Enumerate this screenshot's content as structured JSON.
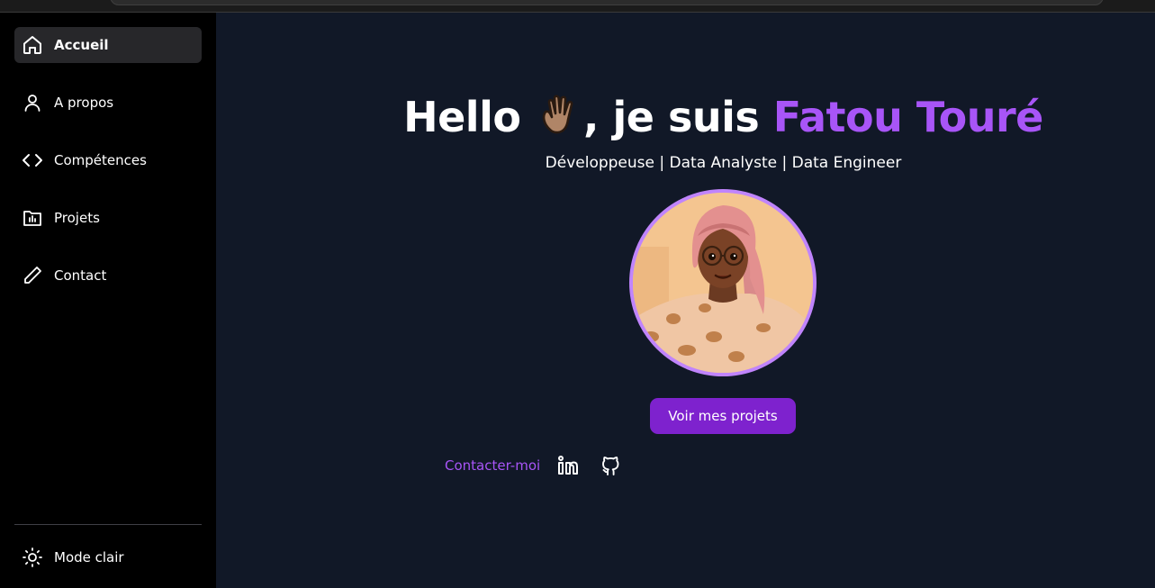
{
  "sidebar": {
    "items": [
      {
        "label": "Accueil",
        "icon": "home-icon",
        "active": true
      },
      {
        "label": "A propos",
        "icon": "user-icon"
      },
      {
        "label": "Compétences",
        "icon": "code-icon"
      },
      {
        "label": "Projets",
        "icon": "folder-chart-icon"
      },
      {
        "label": "Contact",
        "icon": "pencil-icon"
      }
    ],
    "theme_toggle": {
      "label": "Mode clair",
      "icon": "sun-icon"
    }
  },
  "hero": {
    "greeting": "Hello",
    "wave_icon": "waving-hand-icon",
    "intro": ", je suis",
    "name": "Fatou Touré",
    "subtitle": "Développeuse | Data Analyste | Data Engineer",
    "avatar_icon": "profile-illustration",
    "cta_label": "Voir mes projets",
    "contact_label": "Contacter-moi",
    "social": [
      {
        "icon": "linkedin-icon"
      },
      {
        "icon": "github-icon"
      }
    ]
  },
  "colors": {
    "accent": "#a855f7",
    "button": "#7e22ce",
    "background": "#111827",
    "sidebar": "#000000",
    "avatar_border": "#c084fc"
  }
}
